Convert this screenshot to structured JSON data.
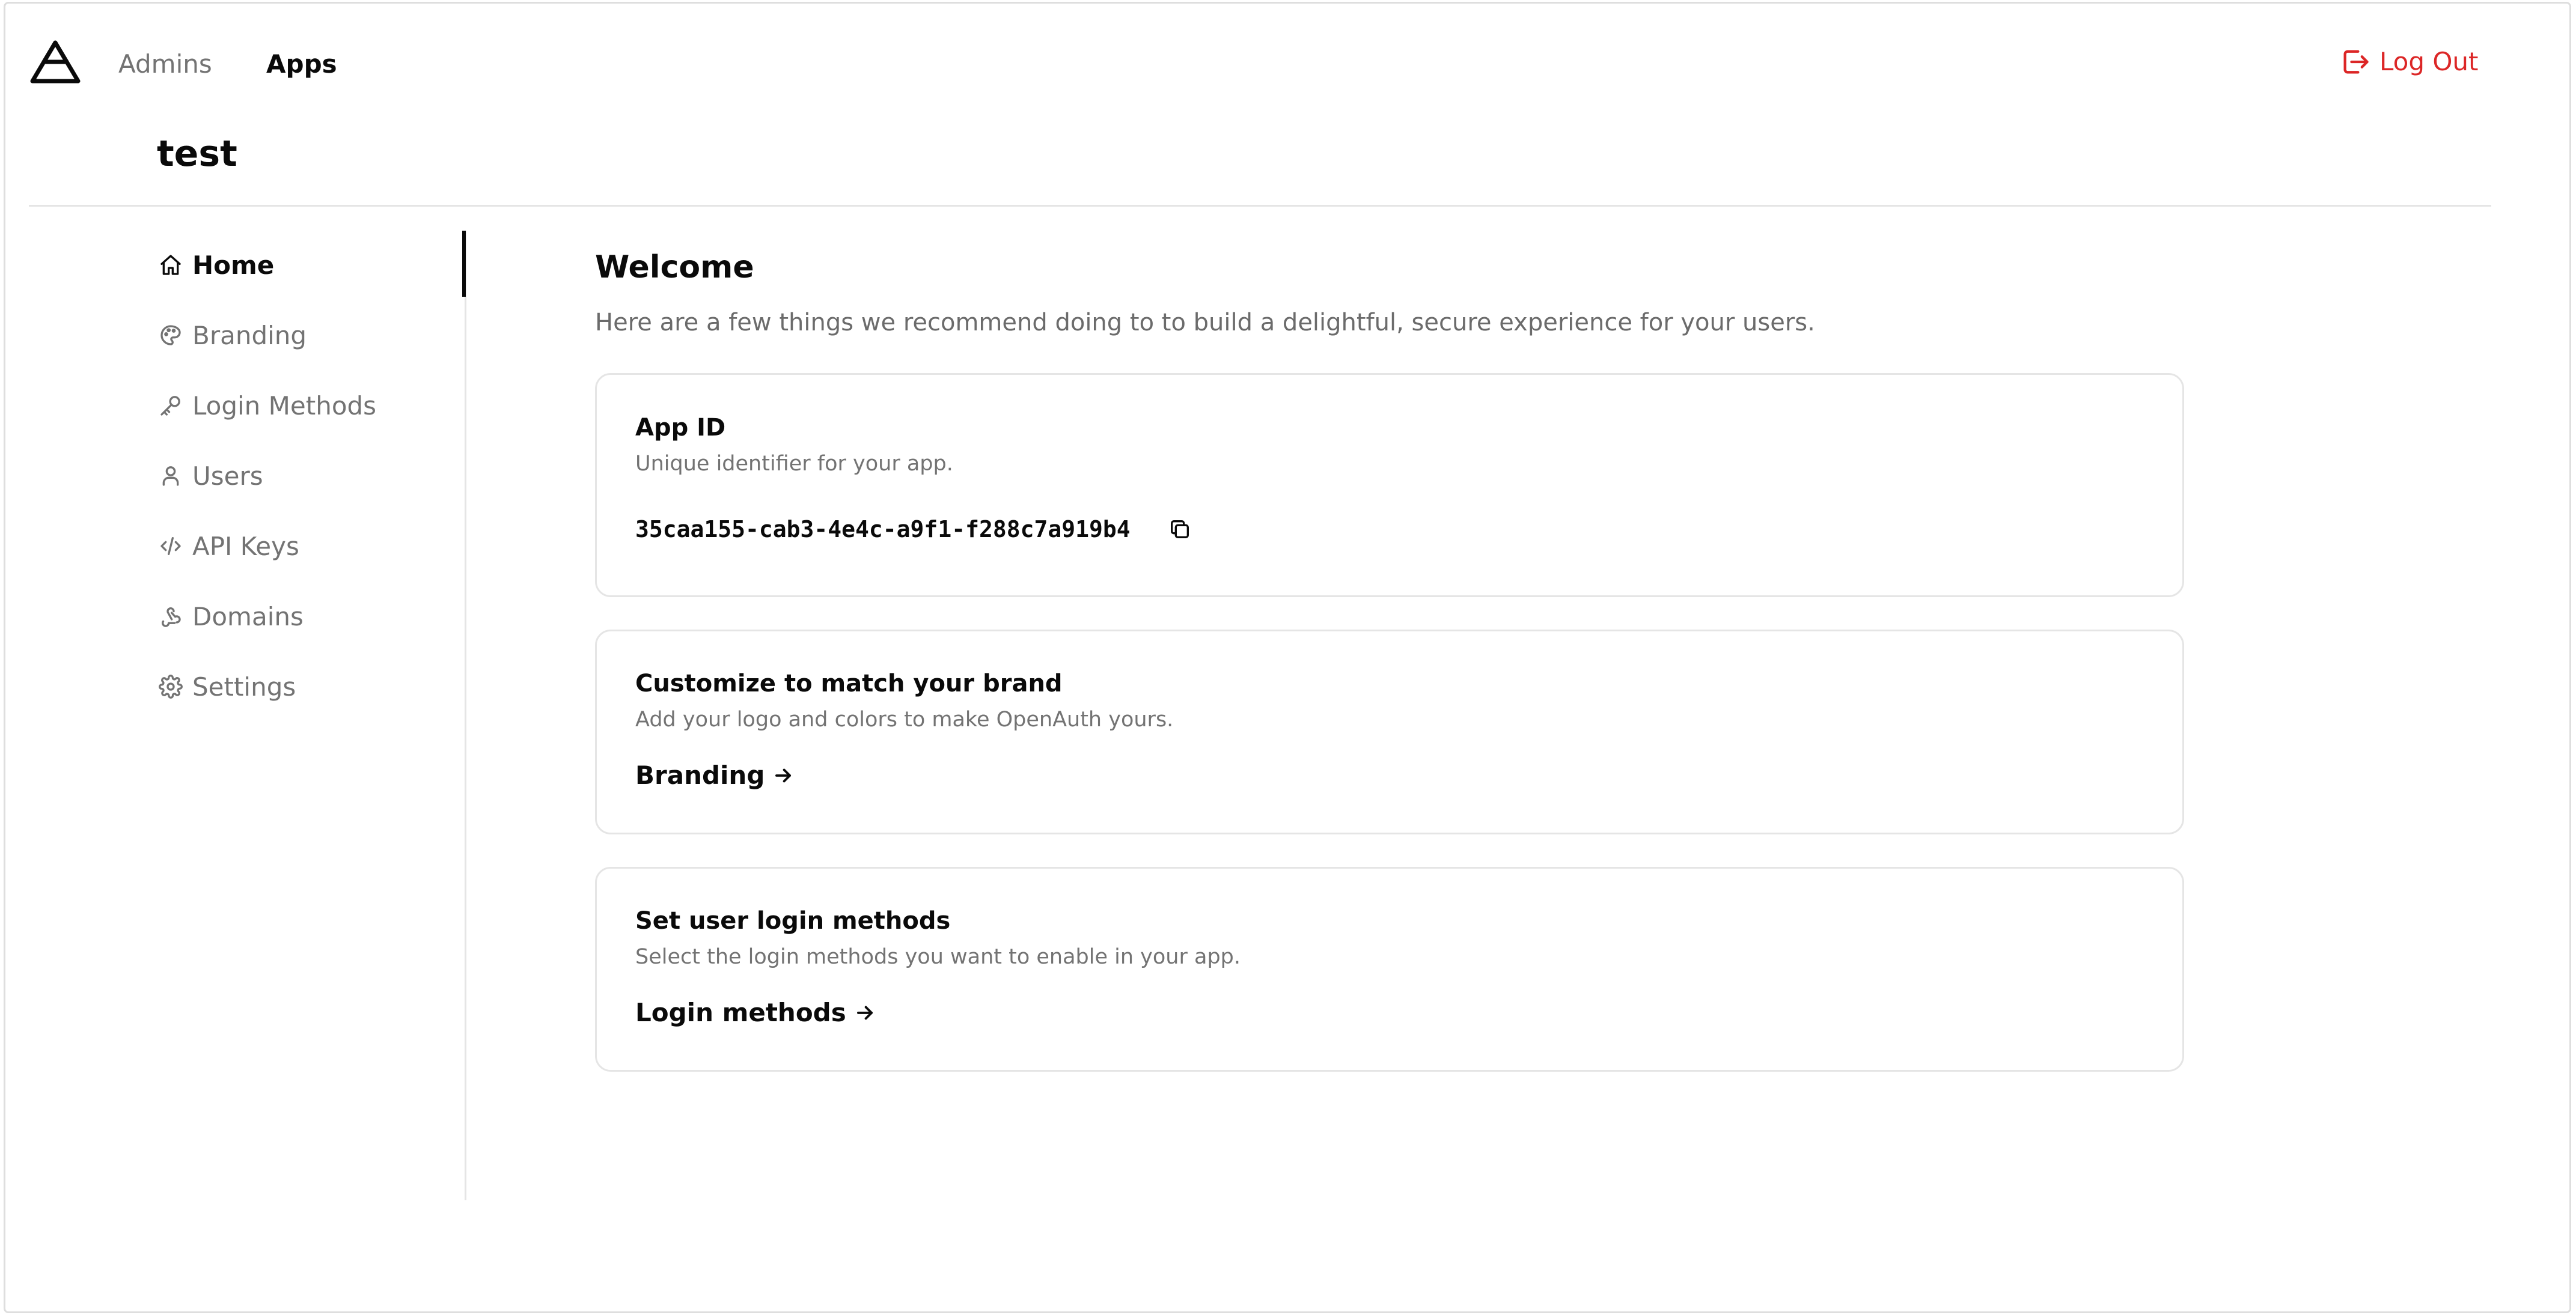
{
  "topnav": {
    "admins_label": "Admins",
    "apps_label": "Apps",
    "logout_label": "Log Out"
  },
  "app": {
    "name": "test"
  },
  "sidebar": {
    "items": [
      {
        "label": "Home",
        "icon": "home-icon",
        "active": true
      },
      {
        "label": "Branding",
        "icon": "palette-icon"
      },
      {
        "label": "Login Methods",
        "icon": "key-icon"
      },
      {
        "label": "Users",
        "icon": "user-icon"
      },
      {
        "label": "API Keys",
        "icon": "code-icon"
      },
      {
        "label": "Domains",
        "icon": "webhook-icon"
      },
      {
        "label": "Settings",
        "icon": "gear-icon"
      }
    ]
  },
  "main": {
    "title": "Welcome",
    "subtitle": "Here are a few things we recommend doing to to build a delightful, secure experience for your users.",
    "cards": [
      {
        "title": "App ID",
        "description": "Unique identifier for your app.",
        "value": "35caa155-cab3-4e4c-a9f1-f288c7a919b4"
      },
      {
        "title": "Customize to match your brand",
        "description": "Add your logo and colors to make OpenAuth yours.",
        "link": "Branding"
      },
      {
        "title": "Set user login methods",
        "description": "Select the login methods you want to enable in your app.",
        "link": "Login methods"
      }
    ]
  },
  "colors": {
    "accent_danger": "#dc2626",
    "text_primary": "#0a0a0a",
    "text_muted": "#737373",
    "border": "#e5e5e5"
  }
}
